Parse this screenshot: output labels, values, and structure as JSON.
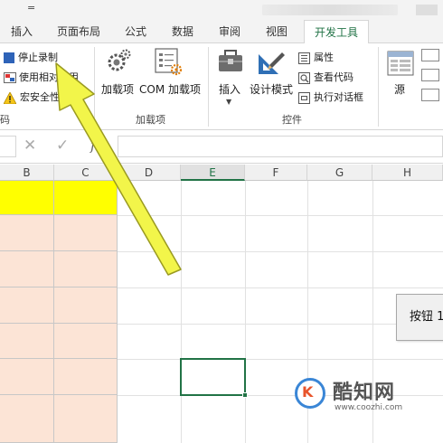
{
  "title": {
    "dropdown_glyph": "="
  },
  "tabs": [
    {
      "id": "insert",
      "label": "插入"
    },
    {
      "id": "pagelayout",
      "label": "页面布局"
    },
    {
      "id": "formulas",
      "label": "公式"
    },
    {
      "id": "data",
      "label": "数据"
    },
    {
      "id": "review",
      "label": "审阅"
    },
    {
      "id": "view",
      "label": "视图"
    },
    {
      "id": "developer",
      "label": "开发工具",
      "active": true
    }
  ],
  "ribbon": {
    "code_group": {
      "label": "码",
      "stop_recording": "停止录制",
      "relative_refs": "使用相对引用",
      "macro_security": "宏安全性"
    },
    "addins_group": {
      "label": "加载项",
      "addins": "加载项",
      "com_addins": "COM 加载项"
    },
    "controls_group": {
      "label": "控件",
      "insert": "插入",
      "design_mode": "设计模式",
      "properties": "属性",
      "view_code": "查看代码",
      "run_dialog": "执行对话框"
    },
    "xml_group": {
      "source": "源"
    }
  },
  "formula_bar": {
    "cancel_glyph": "✕",
    "enter_glyph": "✓",
    "fx_label": "fx",
    "value": ""
  },
  "columns": [
    "B",
    "C",
    "D",
    "E",
    "F",
    "G",
    "H"
  ],
  "selected_column": "E",
  "sheet_button": {
    "label": "按钮 1"
  },
  "watermark": {
    "brand": "酷知网",
    "url": "www.coozhi.com"
  },
  "colors": {
    "accent_green": "#217346",
    "yellow_fill": "#ffff00",
    "peach_fill": "#fce4d6",
    "arrow_yellow": "#f2f54a"
  },
  "icons": [
    "record-stop-icon",
    "relative-ref-icon",
    "warning-icon",
    "gear-icon",
    "com-addins-icon",
    "toolbox-icon",
    "ruler-pencil-icon",
    "properties-icon",
    "view-code-icon",
    "run-dialog-icon",
    "xml-source-icon",
    "cancel-icon",
    "enter-icon",
    "fx-icon"
  ]
}
